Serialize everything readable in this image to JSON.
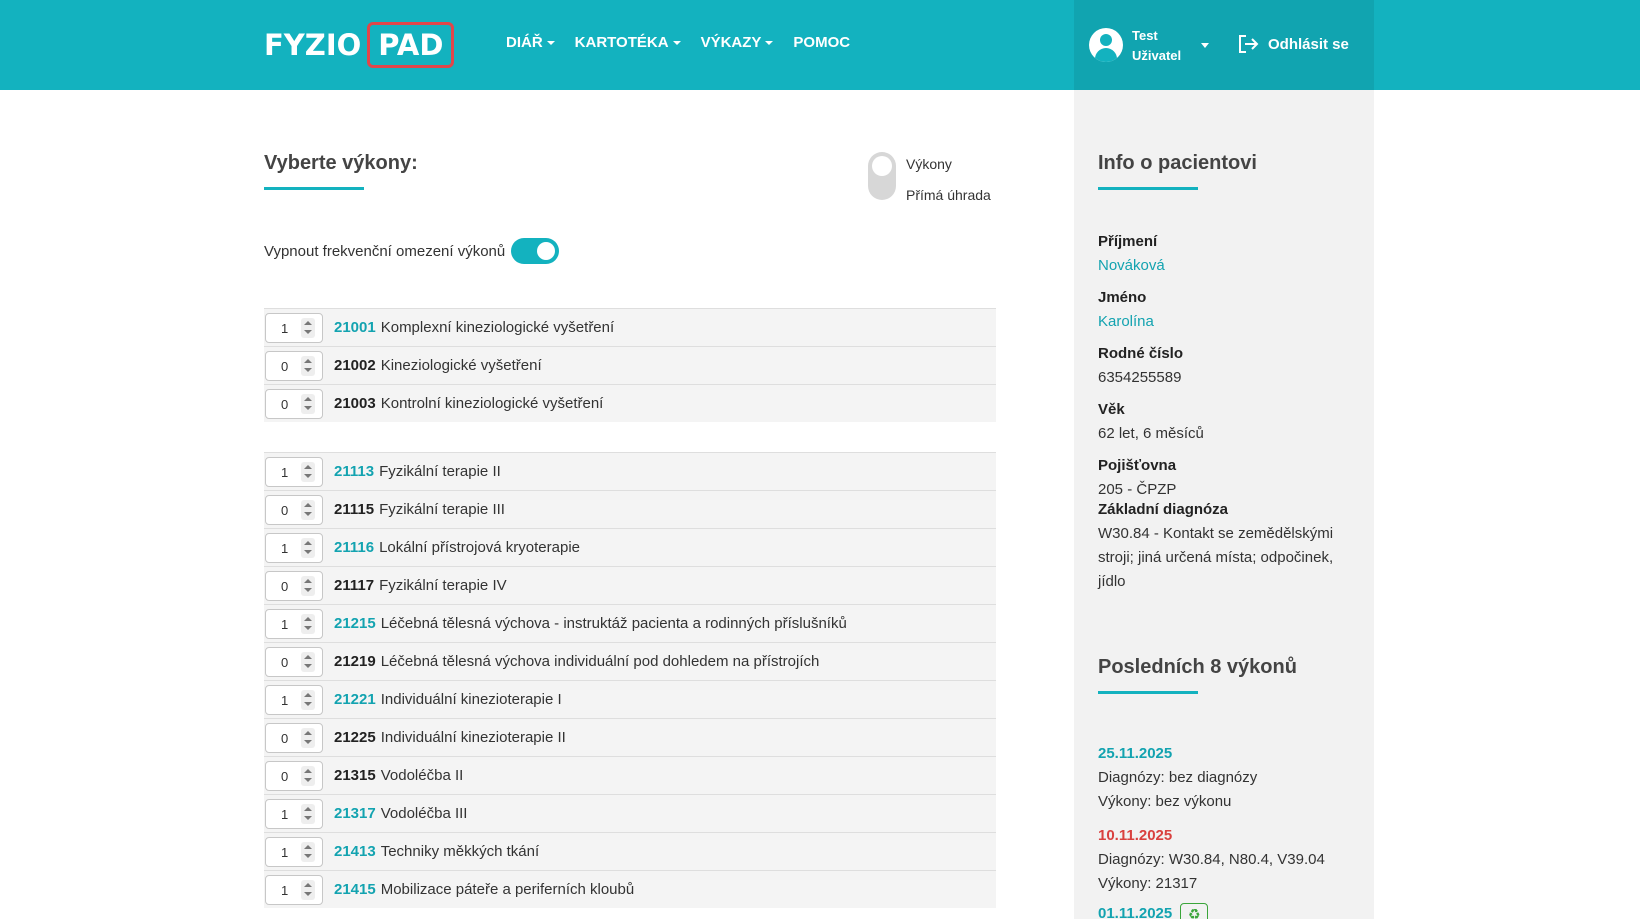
{
  "header": {
    "logo_left": "FYZIO",
    "logo_right": "PAD",
    "nav": [
      {
        "label": "DIÁŘ",
        "dropdown": true
      },
      {
        "label": "KARTOTÉKA",
        "dropdown": true
      },
      {
        "label": "VÝKAZY",
        "dropdown": true
      },
      {
        "label": "POMOC",
        "dropdown": false
      }
    ],
    "user_first": "Test",
    "user_last": "Uživatel",
    "logout_label": "Odhlásit se"
  },
  "main": {
    "title": "Vyberte výkony:",
    "radio_option_1": "Výkony",
    "radio_option_2": "Přímá úhrada",
    "freq_label": "Vypnout frekvenční omezení výkonů",
    "freq_toggle_on": true,
    "groups": [
      {
        "rows": [
          {
            "qty": "1",
            "code": "21001",
            "name": "Komplexní kineziologické vyšetření",
            "active": true
          },
          {
            "qty": "0",
            "code": "21002",
            "name": "Kineziologické vyšetření",
            "active": false
          },
          {
            "qty": "0",
            "code": "21003",
            "name": "Kontrolní kineziologické vyšetření",
            "active": false
          }
        ]
      },
      {
        "rows": [
          {
            "qty": "1",
            "code": "21113",
            "name": "Fyzikální terapie II",
            "active": true
          },
          {
            "qty": "0",
            "code": "21115",
            "name": "Fyzikální terapie III",
            "active": false
          },
          {
            "qty": "1",
            "code": "21116",
            "name": "Lokální přístrojová kryoterapie",
            "active": true
          },
          {
            "qty": "0",
            "code": "21117",
            "name": "Fyzikální terapie IV",
            "active": false
          },
          {
            "qty": "1",
            "code": "21215",
            "name": "Léčebná tělesná výchova - instruktáž pacienta a rodinných příslušníků",
            "active": true
          },
          {
            "qty": "0",
            "code": "21219",
            "name": "Léčebná tělesná výchova individuální pod dohledem na přístrojích",
            "active": false
          },
          {
            "qty": "1",
            "code": "21221",
            "name": "Individuální kinezioterapie I",
            "active": true
          },
          {
            "qty": "0",
            "code": "21225",
            "name": "Individuální kinezioterapie II",
            "active": false
          },
          {
            "qty": "0",
            "code": "21315",
            "name": "Vodoléčba II",
            "active": false
          },
          {
            "qty": "1",
            "code": "21317",
            "name": "Vodoléčba III",
            "active": true
          },
          {
            "qty": "1",
            "code": "21413",
            "name": "Techniky měkkých tkání",
            "active": true
          },
          {
            "qty": "1",
            "code": "21415",
            "name": "Mobilizace páteře a periferních kloubů",
            "active": true
          }
        ]
      }
    ]
  },
  "info": {
    "title": "Info o pacientovi",
    "fields": [
      {
        "label": "Příjmení",
        "value": "Nováková",
        "link": true
      },
      {
        "label": "Jméno",
        "value": "Karolína",
        "link": true
      },
      {
        "label": "Rodné číslo",
        "value": "6354255589",
        "link": false
      },
      {
        "label": "Věk",
        "value": "62 let, 6 měsíců",
        "link": false
      },
      {
        "label": "Pojišťovna",
        "value": "205 - ČPZP",
        "link": false
      }
    ],
    "diagnosis_label": "Základní diagnóza",
    "diagnosis_line_1": "W30.84 - Kontakt se zemědělskými",
    "diagnosis_line_2": "stroji; jiná určená místa; odpočinek,",
    "diagnosis_line_3": "jídlo",
    "recent_title": "Posledních 8 výkonů",
    "visits": [
      {
        "date": "25.11.2025",
        "color": "teal",
        "diag": "Diagnózy: bez diagnózy",
        "proc": "Výkony: bez výkonu"
      },
      {
        "date": "10.11.2025",
        "color": "red",
        "diag": "Diagnózy: W30.84, N80.4, V39.04",
        "proc": "Výkony: 21317"
      },
      {
        "date": "01.11.2025",
        "color": "teal",
        "diag": "",
        "proc": ""
      }
    ],
    "recycle_icon": "recycle-icon"
  },
  "colors": {
    "accent": "#13b2bf",
    "logo_border": "#e0474a",
    "alert": "#d9413f"
  }
}
